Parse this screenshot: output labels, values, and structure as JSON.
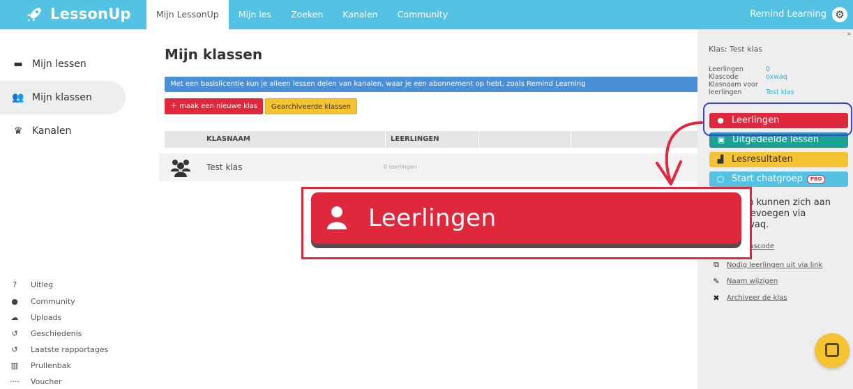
{
  "brand": {
    "name": "LessonUp"
  },
  "topnav": {
    "items": [
      {
        "label": "Mijn LessonUp",
        "active": true
      },
      {
        "label": "Mijn les",
        "active": false
      },
      {
        "label": "Zoeken",
        "active": false
      },
      {
        "label": "Kanalen",
        "active": false
      },
      {
        "label": "Community",
        "active": false
      }
    ],
    "account": "Remind Learning"
  },
  "sidebar": {
    "main": [
      {
        "label": "Mijn lessen",
        "icon": "lessons-icon"
      },
      {
        "label": "Mijn klassen",
        "icon": "classes-icon",
        "active": true
      },
      {
        "label": "Kanalen",
        "icon": "crown-icon"
      }
    ],
    "bottom": [
      {
        "label": "Uitleg",
        "icon": "help-icon"
      },
      {
        "label": "Community",
        "icon": "chat-icon"
      },
      {
        "label": "Uploads",
        "icon": "upload-icon"
      },
      {
        "label": "Geschiedenis",
        "icon": "history-icon"
      },
      {
        "label": "Laatste rapportages",
        "icon": "reports-icon"
      },
      {
        "label": "Prullenbak",
        "icon": "trash-icon"
      },
      {
        "label": "Voucher",
        "icon": "voucher-icon"
      }
    ]
  },
  "main": {
    "title": "Mijn klassen",
    "banner": "Met een basislicentie kun je alleen lessen delen van kanalen, waar je een abonnement op hebt, zoals Remind Learning",
    "new_class_button": "maak een nieuwe klas",
    "archived_button": "Gearchiveerde klassen",
    "table": {
      "headers": [
        "KLASNAAM",
        "LEERLINGEN"
      ],
      "rows": [
        {
          "name": "Test klas",
          "students": "0 leerlingen"
        }
      ]
    }
  },
  "panel": {
    "title": "Klas: Test klas",
    "details": [
      {
        "key": "Leerlingen",
        "value": "0"
      },
      {
        "key": "Klascode",
        "value": "oxwaq"
      },
      {
        "key": "Klasnaam voor",
        "value": ""
      },
      {
        "key": "leerlingen",
        "value": "Test klas"
      }
    ],
    "buttons": [
      {
        "label": "Leerlingen",
        "color": "#e0283c"
      },
      {
        "label": "Uitgedeelde lessen",
        "color": "#1aa394"
      },
      {
        "label": "Lesresultaten",
        "color": "#f5c331"
      },
      {
        "label": "Start chatgroep",
        "color": "#54c3e3",
        "badge": "PRO"
      }
    ],
    "note": "gen kunnen zich aan\nstoevoegen via\noxwaq.",
    "links": [
      {
        "label": "klascode",
        "icon": "link-icon"
      },
      {
        "label": "Nodig leerlingen uit via link",
        "icon": "external-link-icon"
      },
      {
        "label": "Naam wijzigen",
        "icon": "pencil-icon"
      },
      {
        "label": "Archiveer de klas",
        "icon": "close-icon"
      }
    ]
  },
  "zoom": {
    "label": "Leerlingen"
  },
  "colors": {
    "topbar": "#54c3e3",
    "red": "#e0283c",
    "yellow": "#f5c331",
    "blue_banner": "#4a90d9",
    "highlight": "#3b42d6"
  }
}
